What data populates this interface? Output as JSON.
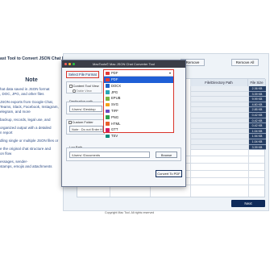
{
  "background": {
    "heading": "ast Tool to Convert JSON Chat Files to Multiple Formats on Mac",
    "note_title": "Note",
    "lines": [
      "hat data saved in JSON format",
      ", DOC, JPG, and other files",
      "",
      "JSON exports from Google Chat,",
      "Teams, Slack, Facebook, Instagram,",
      "elegram, and more",
      "",
      "backup, records, legal use, and",
      "",
      "organized output with a detailed",
      "n report",
      "",
      "dling single or multiple JSON files or",
      "",
      "e the original chat structure and",
      "on flow",
      "",
      "essages, sender-",
      "stamps, emojis and attachments"
    ]
  },
  "app": {
    "remove_label": "Remove",
    "remove_all_label": "Remove All",
    "next_label": "Next",
    "grid": {
      "headers": [
        "File/Directory Path",
        "File Size"
      ],
      "sizes": [
        "2.36 KB",
        "3.39 KB",
        "9.99 KB",
        "4.60 KB",
        "2.85 KB",
        "0.42 KB",
        "0.42 KB",
        "0.42 KB",
        "1.04 KB",
        "1.94 KB",
        "1.04 KB",
        "3.39 KB"
      ]
    },
    "footer_text": "Copyright Mac Tool. All rights reserved"
  },
  "dialog": {
    "title": "MacTools© Mac JSON Chat Converter Tool",
    "select_format_label": "Select File Format",
    "content_tool_view_label": "Content Tool View",
    "table_view_label": "Table View",
    "destination_label": "Destination path",
    "destination_value": "/Users/     /Desktop",
    "custom_folder_label": "Custom Folder",
    "custom_folder_value": "Note : Do not Enter these",
    "log_path_label": "Log Path",
    "log_path_value": "/Users/     /Documents",
    "browse_label": "Browse",
    "convert_label": "Convert To PDF",
    "window_dot_colors": [
      "#ff5f57",
      "#febc2e",
      "#28c840"
    ]
  },
  "dropdown": {
    "current": "PDF",
    "items": [
      {
        "label": "PDF",
        "icon": "pdf-icon",
        "color": "#e53935",
        "selected": true
      },
      {
        "label": "DOCX",
        "icon": "docx-icon",
        "color": "#1e63c9",
        "selected": false
      },
      {
        "label": "JPG",
        "icon": "jpg-icon",
        "color": "#2aa6b8",
        "selected": false
      },
      {
        "label": "EPUB",
        "icon": "epub-icon",
        "color": "#7cb342",
        "selected": false
      },
      {
        "label": "SVG",
        "icon": "svg-icon",
        "color": "#f4a11a",
        "selected": false
      },
      {
        "label": "TIFF",
        "icon": "tiff-icon",
        "color": "#6d4cc2",
        "selected": false
      },
      {
        "label": "PNG",
        "icon": "png-icon",
        "color": "#2e9e4b",
        "selected": false
      },
      {
        "label": "HTML",
        "icon": "html-icon",
        "color": "#e8612c",
        "selected": false
      },
      {
        "label": "GTT",
        "icon": "gtt-icon",
        "color": "#d81b60",
        "selected": false
      },
      {
        "label": "TSV",
        "icon": "tsv-icon",
        "color": "#00897b",
        "selected": false
      }
    ]
  }
}
